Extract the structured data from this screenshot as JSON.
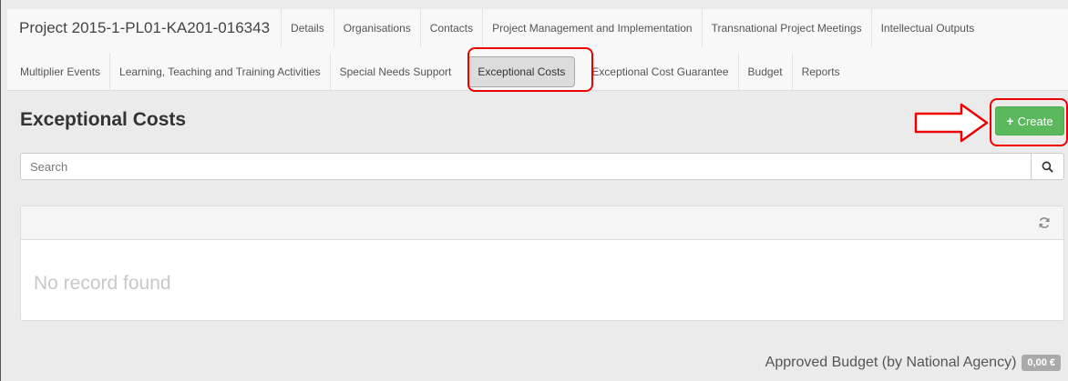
{
  "project": {
    "title": "Project 2015-1-PL01-KA201-016343"
  },
  "nav": {
    "row1": [
      "Details",
      "Organisations",
      "Contacts",
      "Project Management and Implementation",
      "Transnational Project Meetings",
      "Intellectual Outputs"
    ],
    "row2": [
      "Multiplier Events",
      "Learning, Teaching and Training Activities",
      "Special Needs Support",
      "Exceptional Costs",
      "Exceptional Cost Guarantee",
      "Budget",
      "Reports"
    ],
    "active": "Exceptional Costs"
  },
  "page": {
    "title": "Exceptional Costs",
    "create_label": "Create"
  },
  "search": {
    "placeholder": "Search"
  },
  "list": {
    "empty_text": "No record found"
  },
  "budget": {
    "label": "Approved Budget (by National Agency)",
    "value": "0,00 €"
  },
  "colors": {
    "create_button": "#5cb85c",
    "highlight": "#e00000"
  }
}
